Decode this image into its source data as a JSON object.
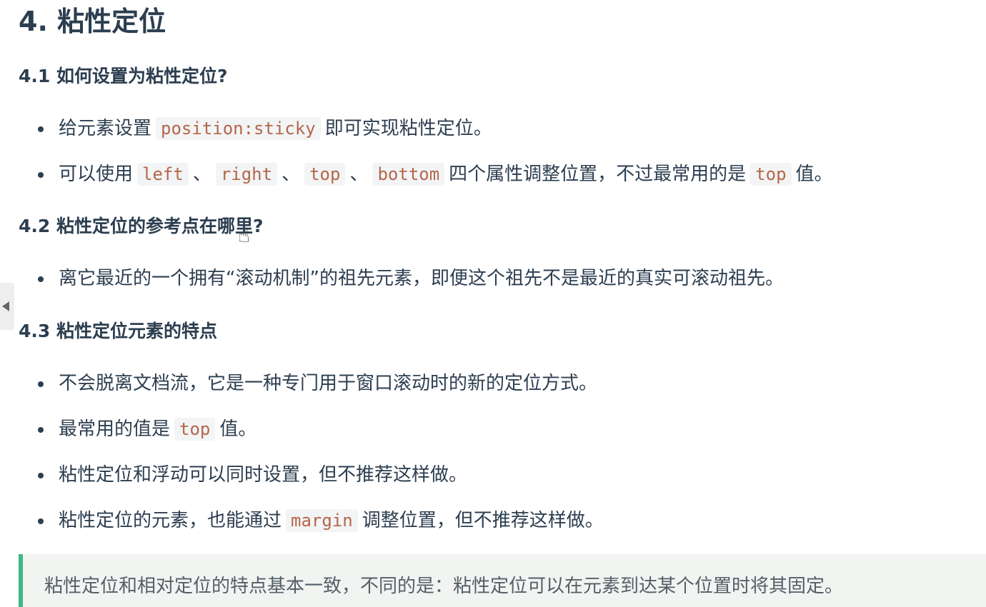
{
  "heading": "4. 粘性定位",
  "sections": [
    {
      "title": "4.1 如何设置为粘性定位?",
      "items": [
        {
          "pre": "给元素设置",
          "code": "position:sticky",
          "post": "即可实现粘性定位。"
        },
        {
          "pre": "可以使用",
          "codes": [
            "left",
            "right",
            "top",
            "bottom"
          ],
          "sep": "、",
          "mid": "四个属性调整位置，不过最常用的是",
          "code2": "top",
          "post": "值。"
        }
      ]
    },
    {
      "title": "4.2 粘性定位的参考点在哪里?",
      "items": [
        {
          "text": "离它最近的一个拥有“滚动机制”的祖先元素，即便这个祖先不是最近的真实可滚动祖先。"
        }
      ]
    },
    {
      "title": "4.3 粘性定位元素的特点",
      "items": [
        {
          "text": "不会脱离文档流，它是一种专门用于窗口滚动时的新的定位方式。"
        },
        {
          "pre": "最常用的值是",
          "code": "top",
          "post": "值。"
        },
        {
          "text": "粘性定位和浮动可以同时设置，但不推荐这样做。"
        },
        {
          "pre": "粘性定位的元素，也能通过",
          "code": "margin",
          "post": "调整位置，但不推荐这样做。"
        }
      ]
    }
  ],
  "tip": "粘性定位和相对定位的特点基本一致，不同的是：粘性定位可以在元素到达某个位置时将其固定。",
  "colors": {
    "text": "#2c3e50",
    "code_text": "#b4664a",
    "code_bg": "#f3f4f5",
    "tip_border": "#41b883",
    "tip_bg": "#f1f4f1"
  },
  "icons": [
    "collapse-arrow-icon",
    "hand-cursor-icon"
  ]
}
